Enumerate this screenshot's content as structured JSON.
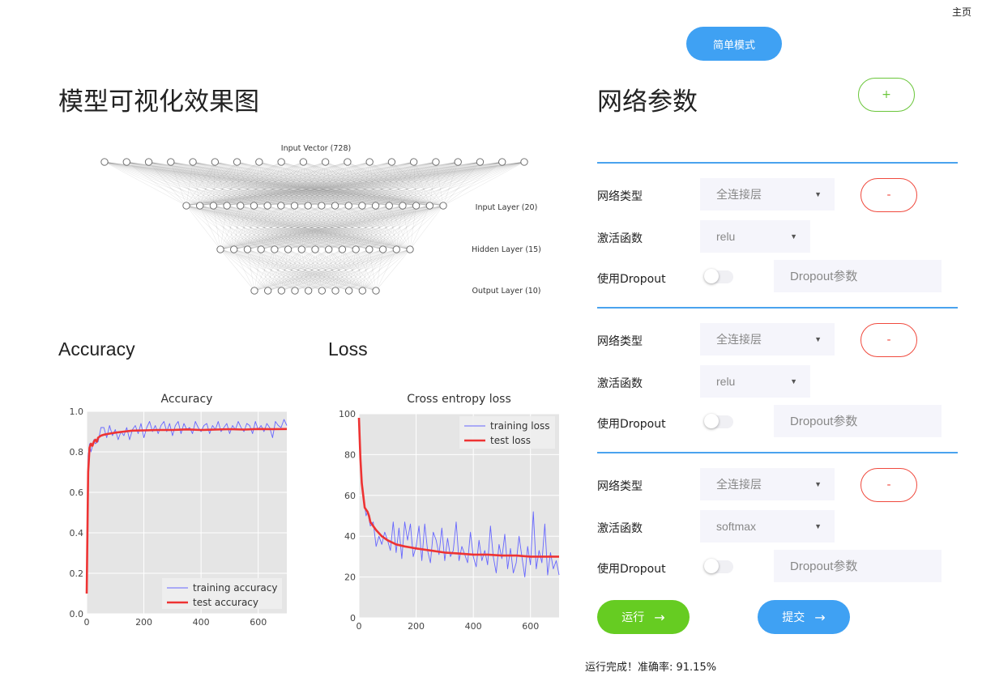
{
  "header": {
    "home_link": "主页",
    "mode_button": "简单模式"
  },
  "left": {
    "title": "模型可视化效果图",
    "network": {
      "layers": [
        {
          "label": "Input Vector (728)",
          "nodes": 20
        },
        {
          "label": "Input Layer (20)",
          "nodes": 20
        },
        {
          "label": "Hidden Layer (15)",
          "nodes": 15
        },
        {
          "label": "Output Layer (10)",
          "nodes": 10
        }
      ]
    },
    "accuracy_heading": "Accuracy",
    "loss_heading": "Loss"
  },
  "right": {
    "title": "网络参数",
    "add_button": "+",
    "layer_labels": {
      "type": "网络类型",
      "activation": "激活函数",
      "dropout": "使用Dropout"
    },
    "layers": [
      {
        "type": "全连接层",
        "activation": "relu",
        "dropout_enabled": false,
        "dropout_placeholder": "Dropout参数",
        "remove_button": "-"
      },
      {
        "type": "全连接层",
        "activation": "relu",
        "dropout_enabled": false,
        "dropout_placeholder": "Dropout参数",
        "remove_button": "-"
      },
      {
        "type": "全连接层",
        "activation": "softmax",
        "dropout_enabled": false,
        "dropout_placeholder": "Dropout参数",
        "remove_button": "-"
      }
    ],
    "run_button": "运行",
    "submit_button": "提交",
    "result_text": "运行完成！准确率:  91.15%"
  },
  "colors": {
    "blue": "#3fa1f3",
    "green": "#66cc22",
    "red": "#f04a3e",
    "plot_bg": "#e5e5e5"
  },
  "chart_data": [
    {
      "type": "line",
      "title": "Accuracy",
      "xlim": [
        0,
        700
      ],
      "ylim": [
        0.0,
        1.0
      ],
      "xticks": [
        "0",
        "200",
        "400",
        "600"
      ],
      "yticks": [
        "0.0",
        "0.2",
        "0.4",
        "0.6",
        "0.8",
        "1.0"
      ],
      "legend": "lower-right",
      "grid": true,
      "series": [
        {
          "name": "training accuracy",
          "color": "#6666ff",
          "x": [
            0,
            5,
            10,
            15,
            20,
            25,
            30,
            40,
            50,
            60,
            70,
            80,
            90,
            100,
            110,
            120,
            130,
            140,
            150,
            160,
            170,
            180,
            190,
            200,
            210,
            220,
            230,
            240,
            250,
            260,
            270,
            280,
            290,
            300,
            310,
            320,
            330,
            340,
            350,
            360,
            370,
            380,
            390,
            400,
            410,
            420,
            430,
            440,
            450,
            460,
            470,
            480,
            490,
            500,
            510,
            520,
            530,
            540,
            550,
            560,
            570,
            580,
            590,
            600,
            610,
            620,
            630,
            640,
            650,
            660,
            670,
            680,
            690,
            700
          ],
          "y": [
            0.12,
            0.78,
            0.84,
            0.8,
            0.83,
            0.86,
            0.84,
            0.85,
            0.92,
            0.92,
            0.87,
            0.93,
            0.88,
            0.91,
            0.86,
            0.9,
            0.88,
            0.92,
            0.86,
            0.91,
            0.93,
            0.89,
            0.94,
            0.87,
            0.92,
            0.95,
            0.9,
            0.93,
            0.89,
            0.93,
            0.95,
            0.9,
            0.94,
            0.88,
            0.93,
            0.95,
            0.89,
            0.94,
            0.91,
            0.92,
            0.89,
            0.95,
            0.92,
            0.9,
            0.93,
            0.94,
            0.89,
            0.93,
            0.91,
            0.95,
            0.9,
            0.92,
            0.94,
            0.89,
            0.93,
            0.91,
            0.95,
            0.92,
            0.9,
            0.94,
            0.93,
            0.89,
            0.95,
            0.91,
            0.93,
            0.9,
            0.94,
            0.92,
            0.87,
            0.95,
            0.93,
            0.92,
            0.96,
            0.93
          ]
        },
        {
          "name": "test accuracy",
          "color": "#ee3333",
          "x": [
            0,
            5,
            10,
            15,
            20,
            25,
            30,
            35,
            40,
            50,
            60,
            80,
            100,
            130,
            160,
            200,
            250,
            300,
            350,
            400,
            450,
            500,
            550,
            600,
            650,
            700
          ],
          "y": [
            0.1,
            0.7,
            0.82,
            0.84,
            0.83,
            0.85,
            0.86,
            0.85,
            0.87,
            0.88,
            0.885,
            0.89,
            0.895,
            0.9,
            0.905,
            0.906,
            0.908,
            0.908,
            0.911,
            0.908,
            0.91,
            0.912,
            0.91,
            0.913,
            0.912,
            0.913
          ]
        }
      ]
    },
    {
      "type": "line",
      "title": "Cross entropy loss",
      "xlim": [
        0,
        700
      ],
      "ylim": [
        0,
        100
      ],
      "xticks": [
        "0",
        "200",
        "400",
        "600"
      ],
      "yticks": [
        "0",
        "20",
        "40",
        "60",
        "80",
        "100"
      ],
      "legend": "top-right",
      "grid": true,
      "series": [
        {
          "name": "training loss",
          "color": "#6666ff",
          "x": [
            0,
            5,
            10,
            15,
            20,
            25,
            30,
            40,
            50,
            60,
            70,
            80,
            90,
            100,
            110,
            120,
            130,
            140,
            150,
            160,
            170,
            180,
            190,
            200,
            210,
            220,
            230,
            240,
            250,
            260,
            270,
            280,
            290,
            300,
            310,
            320,
            330,
            340,
            350,
            360,
            370,
            380,
            390,
            400,
            410,
            420,
            430,
            440,
            450,
            460,
            470,
            480,
            490,
            500,
            510,
            520,
            530,
            540,
            550,
            560,
            570,
            580,
            590,
            600,
            610,
            620,
            630,
            640,
            650,
            660,
            670,
            680,
            690,
            700
          ],
          "y": [
            95,
            75,
            68,
            60,
            55,
            50,
            52,
            45,
            47,
            35,
            40,
            36,
            42,
            38,
            33,
            47,
            32,
            44,
            29,
            47,
            38,
            46,
            30,
            35,
            45,
            28,
            46,
            33,
            27,
            42,
            38,
            31,
            44,
            28,
            39,
            30,
            33,
            47,
            28,
            35,
            31,
            27,
            42,
            30,
            25,
            38,
            28,
            33,
            26,
            45,
            30,
            22,
            36,
            29,
            41,
            24,
            34,
            22,
            27,
            40,
            30,
            20,
            35,
            26,
            52,
            24,
            33,
            27,
            46,
            21,
            32,
            24,
            28,
            21
          ]
        },
        {
          "name": "test loss",
          "color": "#ee3333",
          "x": [
            0,
            5,
            10,
            15,
            20,
            25,
            30,
            35,
            40,
            50,
            60,
            80,
            100,
            130,
            160,
            200,
            250,
            300,
            350,
            400,
            450,
            500,
            550,
            600,
            650,
            700
          ],
          "y": [
            98,
            78,
            66,
            60,
            54,
            53,
            52,
            50,
            47,
            45,
            43,
            40,
            38,
            36,
            35,
            34,
            33,
            32,
            31.5,
            31,
            31,
            30.5,
            30.5,
            30,
            30,
            30
          ]
        }
      ]
    }
  ]
}
